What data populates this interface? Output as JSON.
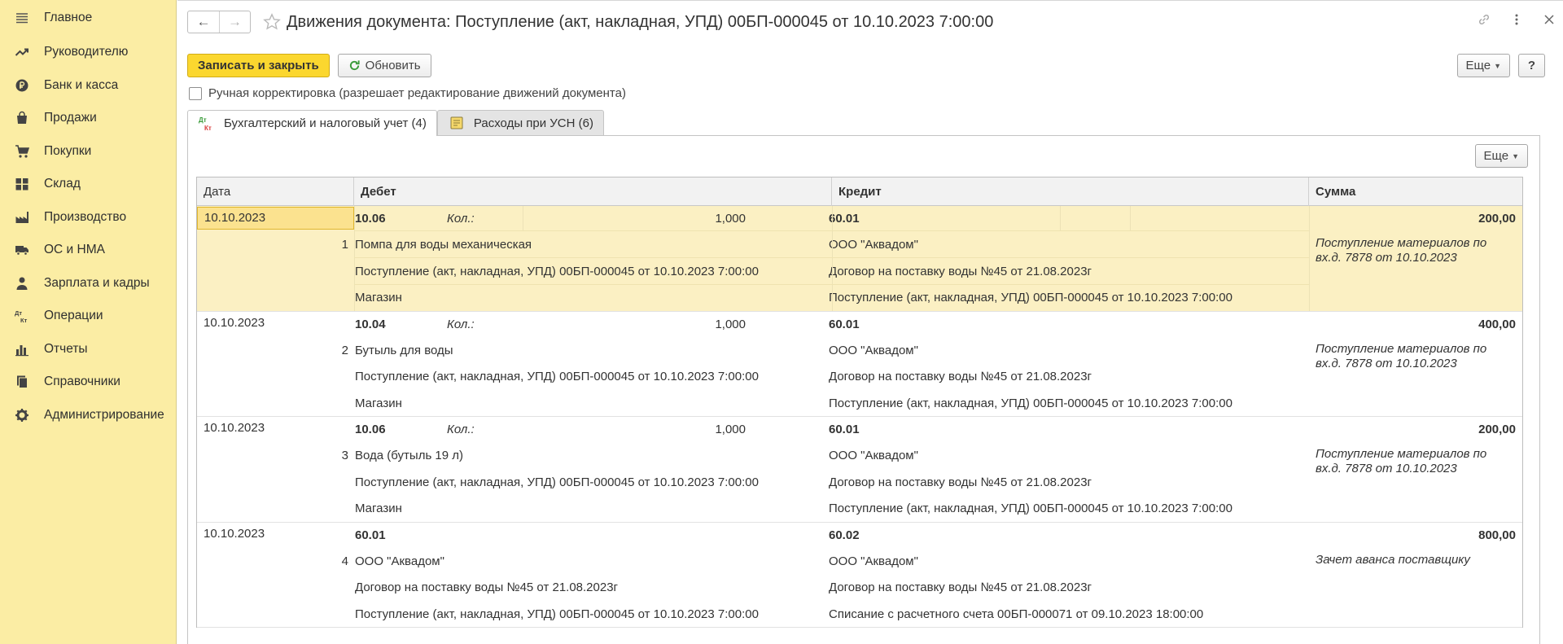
{
  "sidebar": {
    "items": [
      {
        "label": "Главное",
        "icon": "menu-icon"
      },
      {
        "label": "Руководителю",
        "icon": "trend-icon"
      },
      {
        "label": "Банк и касса",
        "icon": "ruble-coin-icon"
      },
      {
        "label": "Продажи",
        "icon": "shopping-bag-icon"
      },
      {
        "label": "Покупки",
        "icon": "cart-icon"
      },
      {
        "label": "Склад",
        "icon": "warehouse-icon"
      },
      {
        "label": "Производство",
        "icon": "factory-icon"
      },
      {
        "label": "ОС и НМА",
        "icon": "truck-icon"
      },
      {
        "label": "Зарплата и кадры",
        "icon": "person-icon"
      },
      {
        "label": "Операции",
        "icon": "dt-kt-icon"
      },
      {
        "label": "Отчеты",
        "icon": "bar-chart-icon"
      },
      {
        "label": "Справочники",
        "icon": "books-icon"
      },
      {
        "label": "Администрирование",
        "icon": "gear-icon"
      }
    ]
  },
  "header": {
    "title": "Движения документа: Поступление (акт, накладная, УПД) 00БП-000045 от 10.10.2023 7:00:00",
    "back_glyph": "←",
    "forward_glyph": "→"
  },
  "toolbar": {
    "save_close_label": "Записать и закрыть",
    "refresh_label": "Обновить",
    "more_label": "Еще",
    "help_label": "?"
  },
  "manual_edit": {
    "label": "Ручная корректировка (разрешает редактирование движений документа)",
    "checked": false
  },
  "tabs": [
    {
      "label": "Бухгалтерский и налоговый учет (4)",
      "active": true,
      "icon": "dt-kt-icon"
    },
    {
      "label": "Расходы при УСН (6)",
      "active": false,
      "icon": "ledger-icon"
    }
  ],
  "table": {
    "more_label": "Еще",
    "headers": {
      "date": "Дата",
      "debit": "Дебет",
      "credit": "Кредит",
      "sum": "Сумма"
    },
    "rows": [
      {
        "date": "10.10.2023",
        "num": "1",
        "debit_account": "10.06",
        "kol_label": "Кол.:",
        "quantity": "1,000",
        "debit_lines": [
          "Помпа для воды механическая",
          "Поступление (акт, накладная, УПД) 00БП-000045 от 10.10.2023 7:00:00",
          "Магазин"
        ],
        "credit_account": "60.01",
        "credit_lines": [
          "ООО \"Аквадом\"",
          "Договор на поставку воды №45 от 21.08.2023г",
          "Поступление (акт, накладная, УПД) 00БП-000045 от 10.10.2023 7:00:00"
        ],
        "sum": "200,00",
        "note": "Поступление материалов по вх.д. 7878 от 10.10.2023",
        "selected": true
      },
      {
        "date": "10.10.2023",
        "num": "2",
        "debit_account": "10.04",
        "kol_label": "Кол.:",
        "quantity": "1,000",
        "debit_lines": [
          "Бутыль для воды",
          "Поступление (акт, накладная, УПД) 00БП-000045 от 10.10.2023 7:00:00",
          "Магазин"
        ],
        "credit_account": "60.01",
        "credit_lines": [
          "ООО \"Аквадом\"",
          "Договор на поставку воды №45 от 21.08.2023г",
          "Поступление (акт, накладная, УПД) 00БП-000045 от 10.10.2023 7:00:00"
        ],
        "sum": "400,00",
        "note": "Поступление материалов по вх.д. 7878 от 10.10.2023",
        "selected": false
      },
      {
        "date": "10.10.2023",
        "num": "3",
        "debit_account": "10.06",
        "kol_label": "Кол.:",
        "quantity": "1,000",
        "debit_lines": [
          "Вода (бутыль 19 л)",
          "Поступление (акт, накладная, УПД) 00БП-000045 от 10.10.2023 7:00:00",
          "Магазин"
        ],
        "credit_account": "60.01",
        "credit_lines": [
          "ООО \"Аквадом\"",
          "Договор на поставку воды №45 от 21.08.2023г",
          "Поступление (акт, накладная, УПД) 00БП-000045 от 10.10.2023 7:00:00"
        ],
        "sum": "200,00",
        "note": "Поступление материалов по вх.д. 7878 от 10.10.2023",
        "selected": false
      },
      {
        "date": "10.10.2023",
        "num": "4",
        "debit_account": "60.01",
        "kol_label": "",
        "quantity": "",
        "debit_lines": [
          "ООО \"Аквадом\"",
          "Договор на поставку воды №45 от 21.08.2023г",
          "Поступление (акт, накладная, УПД) 00БП-000045 от 10.10.2023 7:00:00"
        ],
        "credit_account": "60.02",
        "credit_lines": [
          "ООО \"Аквадом\"",
          "Договор на поставку воды №45 от 21.08.2023г",
          "Списание с расчетного счета 00БП-000071 от 09.10.2023 18:00:00"
        ],
        "sum": "800,00",
        "note": "Зачет аванса поставщику",
        "selected": false
      }
    ]
  },
  "colors": {
    "sidebar_bg": "#fbeda4",
    "primary_button": "#fbd72f",
    "selected_row": "#fbf0c3"
  }
}
